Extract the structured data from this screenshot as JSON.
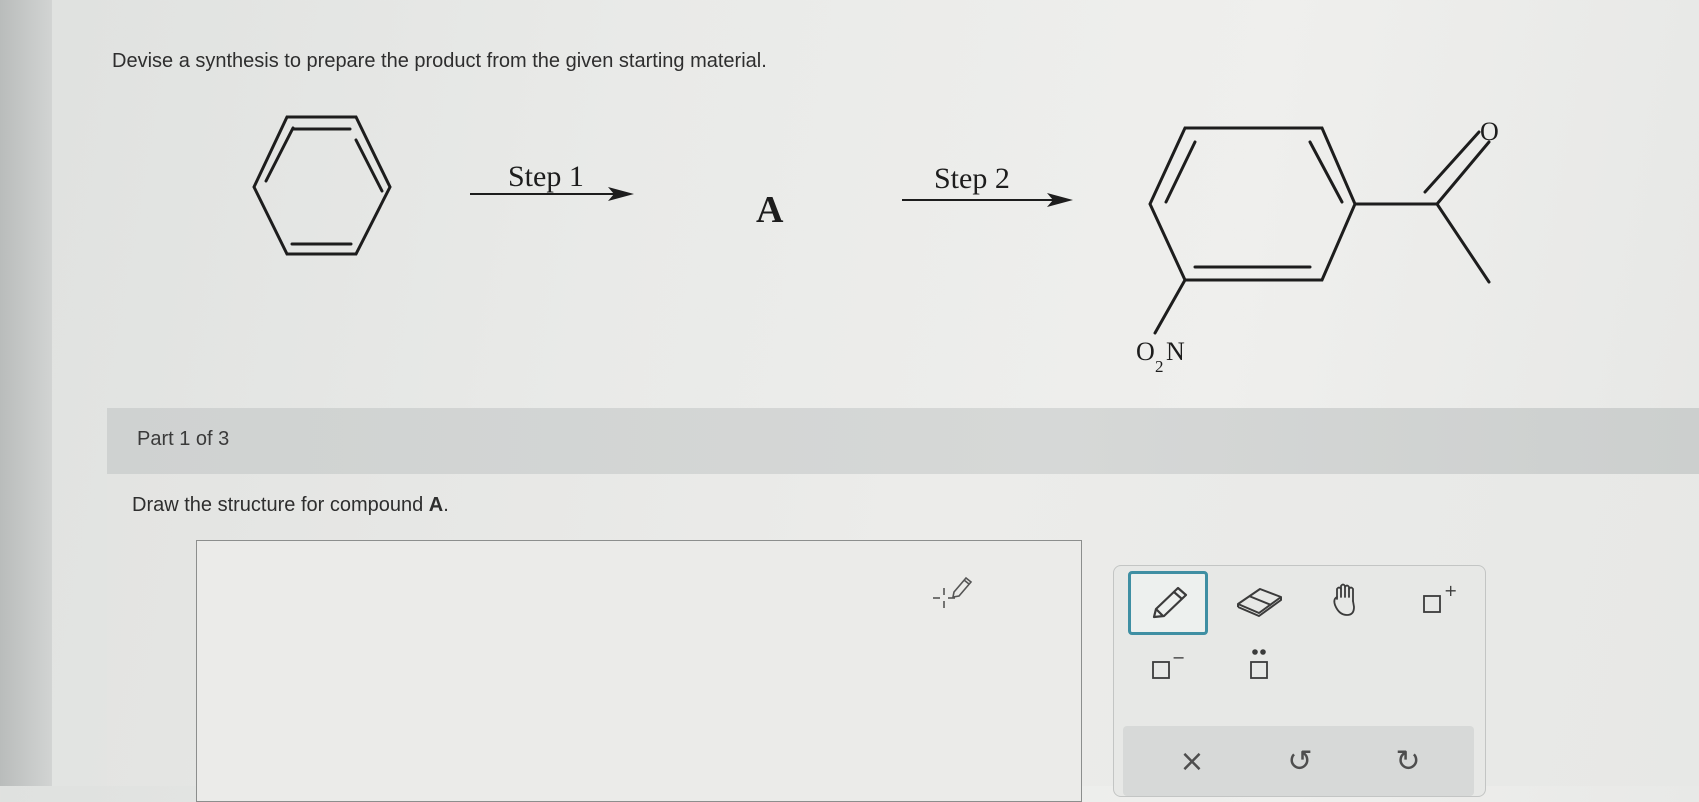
{
  "question": {
    "instruction": "Devise a synthesis to prepare the product from the given starting material.",
    "scheme": {
      "step1_label": "Step 1",
      "intermediate_label": "A",
      "step2_label": "Step 2",
      "product_carbonyl_oxygen": "O",
      "product_nitro_group": {
        "o": "O",
        "subscript": "2",
        "n": "N"
      }
    }
  },
  "part": {
    "label": "Part 1 of 3",
    "prompt_prefix": "Draw the structure for compound ",
    "prompt_compound": "A",
    "prompt_suffix": "."
  },
  "toolbox": {
    "tools": [
      {
        "name": "pencil-tool",
        "icon": "pencil-icon",
        "selected": true
      },
      {
        "name": "eraser-tool",
        "icon": "eraser-icon",
        "selected": false
      },
      {
        "name": "pan-tool",
        "icon": "hand-icon",
        "selected": false
      },
      {
        "name": "positive-charge-tool",
        "icon": "plus-charge-icon",
        "selected": false
      },
      {
        "name": "negative-charge-tool",
        "icon": "minus-charge-icon",
        "selected": false
      },
      {
        "name": "lone-pair-tool",
        "icon": "lone-pair-icon",
        "selected": false
      }
    ],
    "actions": {
      "clear": "×",
      "undo": "↺",
      "redo": "↻"
    },
    "charge_plus": "+",
    "charge_minus": "−"
  },
  "colors": {
    "accent": "#3f8fa3",
    "part_bar": "#d3d5d4",
    "text": "#2e2e2e"
  }
}
